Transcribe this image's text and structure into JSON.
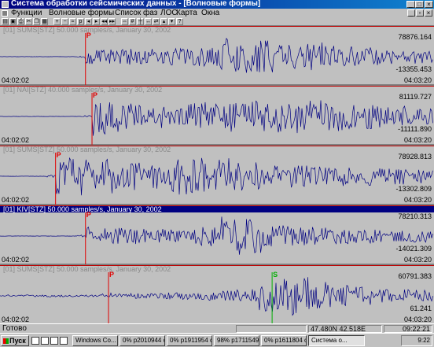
{
  "window": {
    "title": "Система обработки сейсмических данных - [Волновые формы]"
  },
  "menu": {
    "items": [
      "Функции",
      "Волновые формы",
      "Список фаз",
      "ЛОС",
      "Карта",
      "Окна"
    ]
  },
  "toolbar": {
    "buttons": [
      "open-icon",
      "save-icon",
      "print-icon",
      "cut-icon",
      "copy-icon",
      "paste-icon",
      "zoom-in-icon",
      "zoom-out-icon",
      "filter-icon",
      "pick-icon",
      "arrow-left-icon",
      "arrow-right-icon",
      "first-icon",
      "last-icon",
      "fit-icon",
      "grid-icon",
      "ruler-icon",
      "stretch-icon",
      "shrink-icon",
      "up-icon",
      "down-icon",
      "help-icon"
    ]
  },
  "panels": [
    {
      "header": "[01]    SUMS[STZ] 50.000 samples/s, January 30, 2002",
      "max": "78876.164",
      "min": "-13355.453",
      "t_start": "04:02:02",
      "t_end": "04:03:20",
      "active": false,
      "phases": [
        {
          "label": "P",
          "pos": 0.197,
          "color": "#e00000"
        }
      ],
      "onset": 0.197,
      "quiet": 0.006,
      "lead": 0.02,
      "amp": [
        0.35,
        0.4,
        0.38,
        0.42,
        0.5,
        0.95,
        0.8,
        0.6,
        0.7,
        0.55,
        0.45,
        0.4,
        0.35
      ]
    },
    {
      "header": "[01]    NAI[STZ] 40.000 samples/s, January 30, 2002",
      "max": "81119.727",
      "min": "-11111.890",
      "t_start": "04:02:02",
      "t_end": "04:03:20",
      "active": false,
      "phases": [
        {
          "label": "P",
          "pos": 0.212,
          "color": "#e00000"
        }
      ],
      "onset": 0.212,
      "quiet": 0.006,
      "lead": 0.02,
      "amp": [
        0.95,
        0.7,
        0.6,
        0.65,
        0.7,
        0.75,
        0.9,
        0.85,
        0.8,
        0.75,
        0.6,
        0.5,
        0.4
      ]
    },
    {
      "header": "[01]    SUMS[STZ] 50.000 samples/s, January 30, 2002",
      "max": "78928.813",
      "min": "-13302.809",
      "t_start": "04:02:02",
      "t_end": "04:03:20",
      "active": false,
      "phases": [
        {
          "label": "P",
          "pos": 0.128,
          "color": "#e00000"
        }
      ],
      "onset": 0.128,
      "quiet": 0.006,
      "lead": 0.02,
      "amp": [
        0.95,
        0.85,
        0.7,
        0.65,
        0.95,
        0.9,
        0.7,
        0.6,
        0.55,
        0.5,
        0.45,
        0.4,
        0.35
      ]
    },
    {
      "header": "[01]    KIV[STZ] 50.000 samples/s, January 30, 2002",
      "max": "78210.313",
      "min": "-14021.309",
      "t_start": "04:02:02",
      "t_end": "04:03:20",
      "active": true,
      "phases": [
        {
          "label": "P",
          "pos": 0.197,
          "color": "#e00000"
        }
      ],
      "onset": 0.197,
      "quiet": 0.006,
      "lead": 0.02,
      "amp": [
        0.45,
        0.4,
        0.35,
        0.35,
        0.5,
        0.95,
        0.85,
        0.55,
        0.45,
        0.4,
        0.35,
        0.3,
        0.3
      ]
    },
    {
      "header": "[01]    SUMS[STZ] 50.000 samples/s, January 30, 2002",
      "max": "60791.383",
      "min": "61.241",
      "t_start": "04:02:02",
      "t_end": "04:03:20",
      "active": false,
      "phases": [
        {
          "label": "P",
          "pos": 0.25,
          "color": "#e00000"
        },
        {
          "label": "S",
          "pos": 0.627,
          "color": "#00b000"
        }
      ],
      "onset": 0.25,
      "quiet": 0.05,
      "lead": 0.015,
      "amp": [
        0.15,
        0.15,
        0.2,
        0.2,
        0.25,
        0.35,
        0.8,
        0.95,
        0.7,
        0.55,
        0.45,
        0.35,
        0.3
      ]
    }
  ],
  "status": {
    "ready": "Готово",
    "coords": "47.480N 42.518E",
    "time": "09:22:21"
  },
  "taskbar": {
    "start": "Пуск",
    "tasks": [
      "Windows Co...",
      "0% p2010944 c...",
      "0% p1911954 c...",
      "98% p1711549 ...",
      "0% p1611804 c...",
      "Система о..."
    ],
    "clock": "9:22"
  },
  "colors": {
    "trace": "#000080",
    "p_pick": "#e00000",
    "s_pick": "#00b000",
    "active_header": "#000080"
  }
}
